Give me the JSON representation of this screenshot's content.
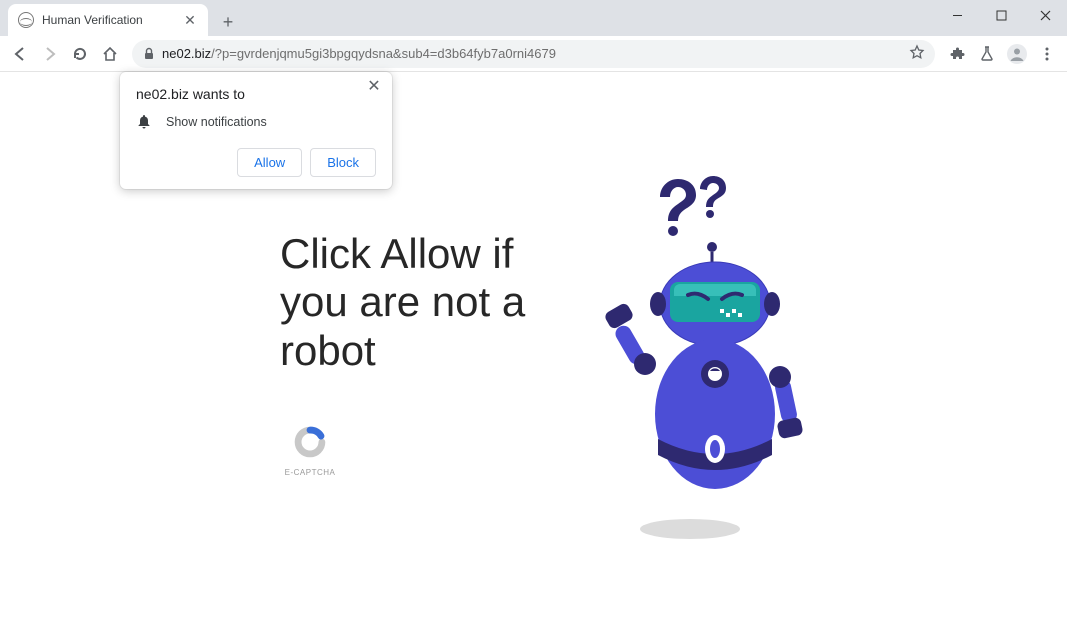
{
  "tab": {
    "title": "Human Verification"
  },
  "omnibox": {
    "domain": "ne02.biz",
    "path": "/?p=gvrdenjqmu5gi3bpgqydsna&sub4=d3b64fyb7a0rni4679"
  },
  "permission_popup": {
    "title": "ne02.biz wants to",
    "permission_label": "Show notifications",
    "allow_label": "Allow",
    "block_label": "Block"
  },
  "page": {
    "headline": "Click Allow if you are not a robot",
    "captcha_label": "E-CAPTCHA"
  },
  "colors": {
    "accent_blue": "#1a73e8",
    "robot_primary": "#4c4ed6",
    "robot_dark": "#2e2970",
    "robot_teal": "#1aa5a0"
  }
}
